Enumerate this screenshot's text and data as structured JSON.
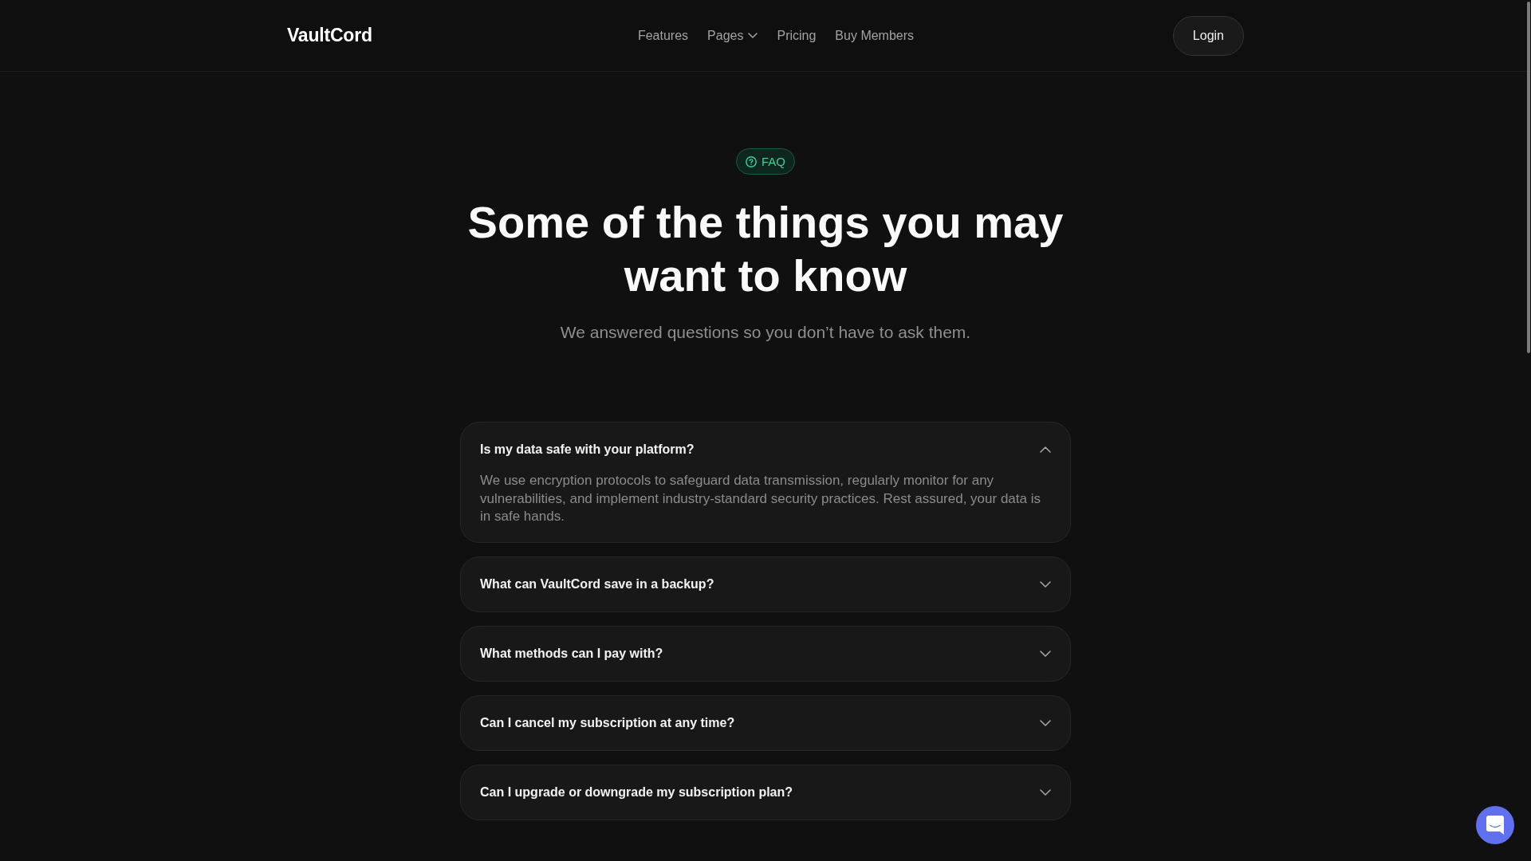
{
  "header": {
    "logo": "VaultCord",
    "nav": [
      {
        "label": "Features",
        "dropdown": false
      },
      {
        "label": "Pages",
        "dropdown": true
      },
      {
        "label": "Pricing",
        "dropdown": false
      },
      {
        "label": "Buy Members",
        "dropdown": false
      }
    ],
    "login_button": "Login"
  },
  "hero": {
    "badge": "FAQ",
    "title": "Some of the things you may want to know",
    "subtitle": "We answered questions so you don’t have to ask them."
  },
  "faq": [
    {
      "question": "Is my data safe with your platform?",
      "expanded": true,
      "answer": "We use encryption protocols to safeguard data transmission, regularly monitor for any vulnerabilities, and implement industry-standard security practices. Rest assured, your data is in safe hands."
    },
    {
      "question": "What can VaultCord save in a backup?",
      "expanded": false
    },
    {
      "question": "What methods can I pay with?",
      "expanded": false
    },
    {
      "question": "Can I cancel my subscription at any time?",
      "expanded": false
    },
    {
      "question": "Can I upgrade or downgrade my subscription plan?",
      "expanded": false
    }
  ]
}
